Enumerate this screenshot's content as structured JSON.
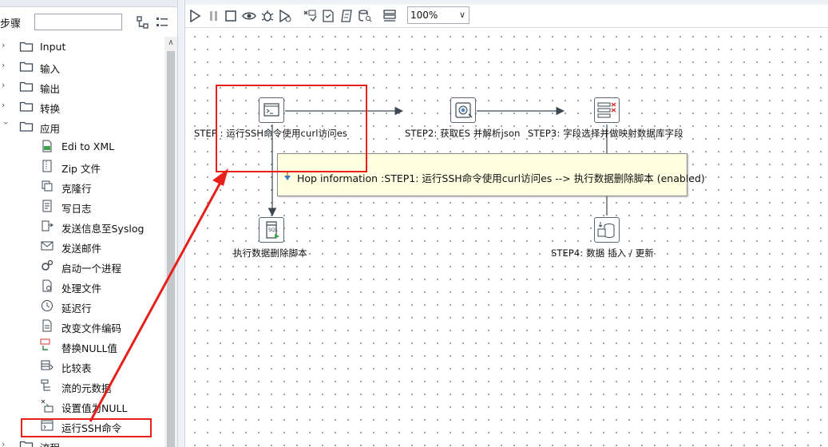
{
  "left": {
    "steps_label": "步骤",
    "search_value": "",
    "tree": [
      {
        "label": "Input",
        "icon": "folder-icon",
        "expanded": false
      },
      {
        "label": "输入",
        "icon": "folder-icon",
        "expanded": false
      },
      {
        "label": "输出",
        "icon": "folder-icon",
        "expanded": false
      },
      {
        "label": "转换",
        "icon": "folder-icon",
        "expanded": false
      },
      {
        "label": "应用",
        "icon": "folder-icon",
        "expanded": true
      },
      {
        "label": "Edi to XML",
        "icon": "edi-xml-icon"
      },
      {
        "label": "Zip 文件",
        "icon": "zip-file-icon"
      },
      {
        "label": "克隆行",
        "icon": "clone-row-icon"
      },
      {
        "label": "写日志",
        "icon": "write-log-icon"
      },
      {
        "label": "发送信息至Syslog",
        "icon": "syslog-icon"
      },
      {
        "label": "发送邮件",
        "icon": "mail-icon"
      },
      {
        "label": "启动一个进程",
        "icon": "process-gear-icon"
      },
      {
        "label": "处理文件",
        "icon": "process-file-icon"
      },
      {
        "label": "延迟行",
        "icon": "clock-icon"
      },
      {
        "label": "改变文件编码",
        "icon": "file-encoding-icon"
      },
      {
        "label": "替换NULL值",
        "icon": "replace-null-icon"
      },
      {
        "label": "比较表",
        "icon": "compare-table-icon"
      },
      {
        "label": "流的元数据",
        "icon": "stream-metadata-icon"
      },
      {
        "label": "设置值为NULL",
        "icon": "set-null-icon"
      },
      {
        "label": "运行SSH命令",
        "icon": "ssh-terminal-icon"
      },
      {
        "label": "流程",
        "icon": "folder-icon",
        "expanded": false
      }
    ]
  },
  "toolbar": {
    "zoom": "100%"
  },
  "canvas": {
    "steps": {
      "step1": "STEP : 运行SSH命令使用curl访问es",
      "step2": "STEP2: 获取ES 并解析json",
      "step3": "STEP3: 字段选择并做映射数据库字段",
      "step4": "STEP4: 数据 插入 / 更新",
      "delete_script": "执行数据删除脚本"
    },
    "hop_info": "Hop information :STEP1: 运行SSH命令使用curl访问es --> 执行数据删除脚本 (enabled)"
  },
  "annotation_color": "#e8201c"
}
